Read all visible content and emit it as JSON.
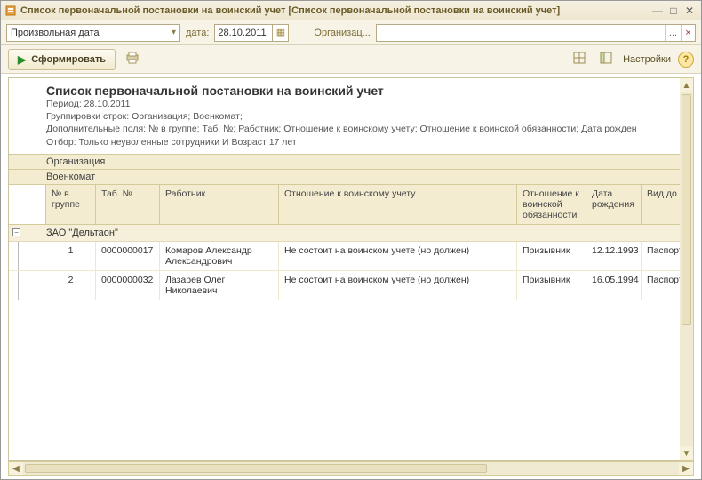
{
  "window": {
    "title": "Список первоначальной постановки на воинский учет [Список первоначальной постановки на воинский учет]"
  },
  "toolbar1": {
    "period_mode": "Произвольная дата",
    "date_label": "дата:",
    "date_value": "28.10.2011",
    "org_label": "Организац...",
    "org_value": "",
    "org_dots": "...",
    "org_clear": "×"
  },
  "toolbar2": {
    "generate_label": "Сформировать",
    "settings_label": "Настройки",
    "help_label": "?"
  },
  "report": {
    "title": "Список первоначальной постановки на воинский учет",
    "meta": {
      "period": "Период: 28.10.2011",
      "groupings": "Группировки строк: Организация; Военкомат;",
      "extra_fields": "Дополнительные поля: № в группе; Таб. №; Работник; Отношение к воинскому учету; Отношение к воинской обязанности; Дата рожден",
      "filter": "Отбор: Только неуволенные сотрудники И Возраст 17 лет"
    },
    "group_bands": [
      "Организация",
      "Военкомат"
    ],
    "columns": {
      "num": "№ в группе",
      "tab": "Таб. №",
      "emp": "Работник",
      "rel": "Отношение к воинскому учету",
      "ob": "Отношение к воинской обязанности",
      "dob": "Дата рождения",
      "doc": "Вид до"
    },
    "group_row": "ЗАО \"Дельтаон\"",
    "rows": [
      {
        "num": "1",
        "tab": "0000000017",
        "emp": "Комаров Александр Александрович",
        "rel": "Не состоит на воинском учете (но должен)",
        "ob": "Призывник",
        "dob": "12.12.1993",
        "doc": "Паспорт"
      },
      {
        "num": "2",
        "tab": "0000000032",
        "emp": "Лазарев Олег Николаевич",
        "rel": "Не состоит на воинском учете (но должен)",
        "ob": "Призывник",
        "dob": "16.05.1994",
        "doc": "Паспорт"
      }
    ]
  }
}
